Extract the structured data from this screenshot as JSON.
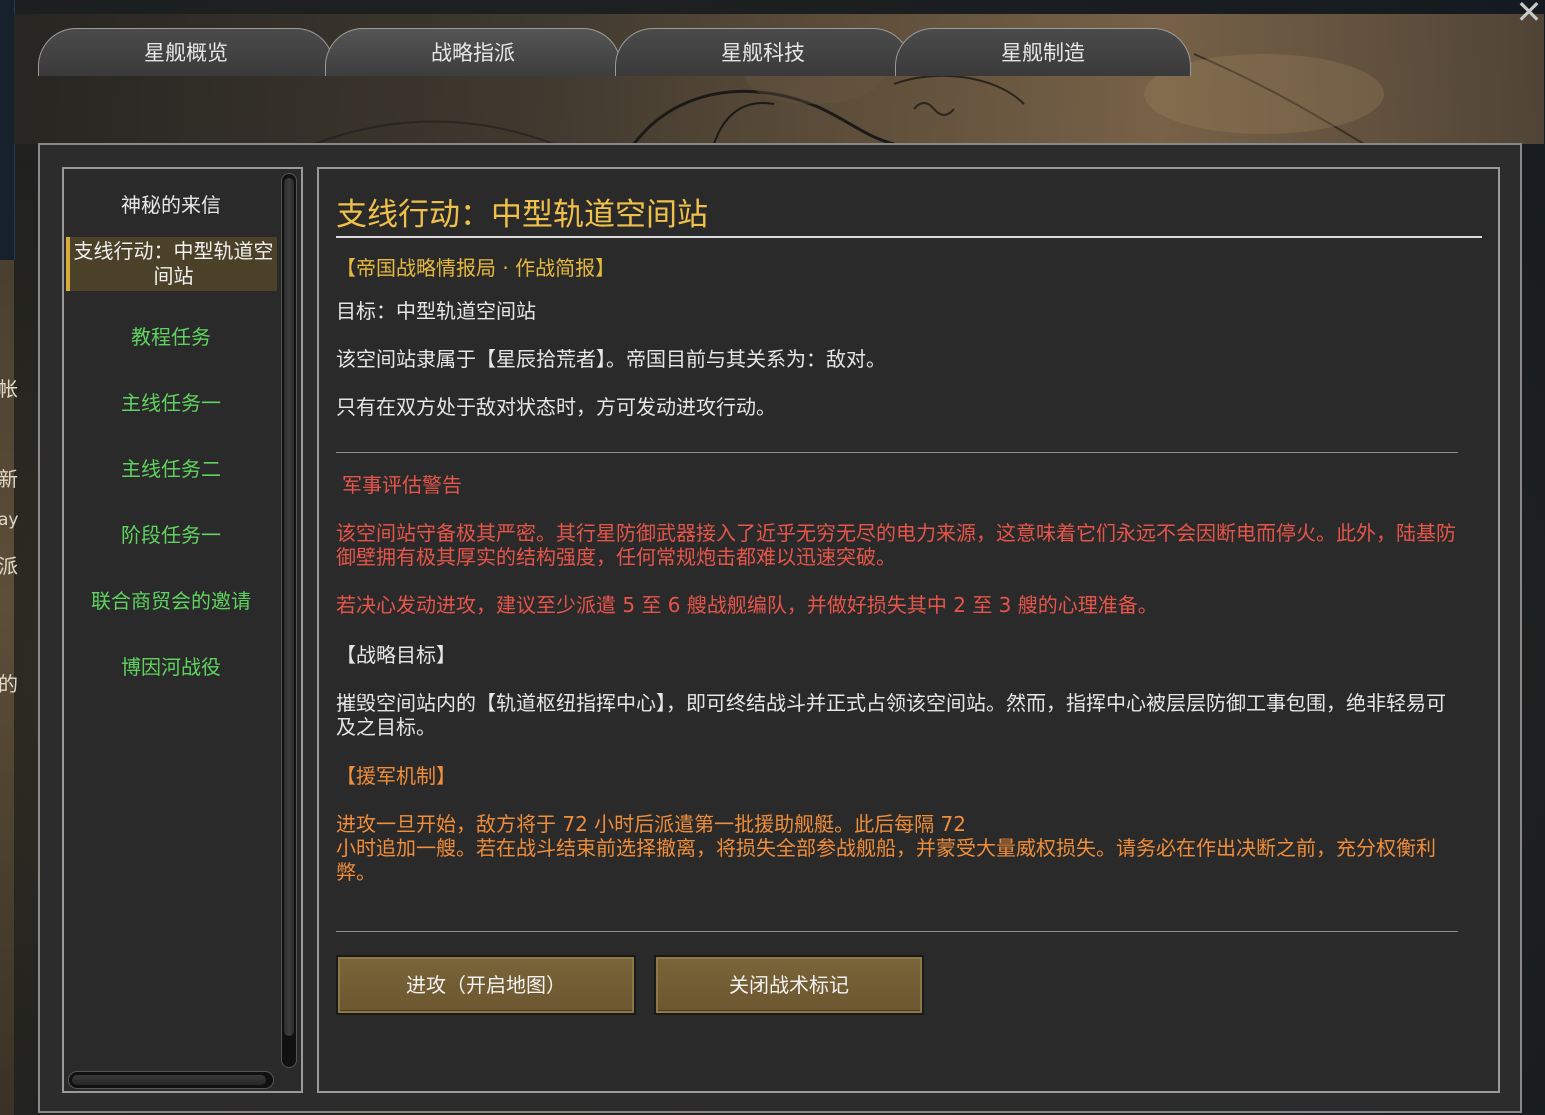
{
  "tabs": [
    {
      "label": "星舰概览"
    },
    {
      "label": "战略指派"
    },
    {
      "label": "星舰科技"
    },
    {
      "label": "星舰制造"
    }
  ],
  "close_symbol": "✕",
  "background_edge_glyphs": [
    "帐",
    "新",
    "ay",
    "派",
    "的"
  ],
  "missions": [
    {
      "label": "神秘的来信",
      "color": "#e8e8e8"
    },
    {
      "label": "支线行动：中型轨道空间站",
      "color": "#f0f0f0",
      "selected": true
    },
    {
      "label": "教程任务",
      "color": "#5fd35f"
    },
    {
      "label": "主线任务一",
      "color": "#5fd35f"
    },
    {
      "label": "主线任务二",
      "color": "#5fd35f"
    },
    {
      "label": "阶段任务一",
      "color": "#5fd35f"
    },
    {
      "label": "联合商贸会的邀请",
      "color": "#5fd35f"
    },
    {
      "label": "博因河战役",
      "color": "#5fd35f"
    }
  ],
  "content": {
    "title": "支线行动：中型轨道空间站",
    "briefing_header": "【帝国战略情报局 · 作战简报】",
    "target": "目标：中型轨道空间站",
    "affiliation": "该空间站隶属于【星辰拾荒者】。帝国目前与其关系为：敌对。",
    "condition": "只有在双方处于敌对状态时，方可发动进攻行动。",
    "warning_header": "军事评估警告",
    "warning_text": "该空间站守备极其严密。其行星防御武器接入了近乎无穷无尽的电力来源，这意味着它们永远不会因断电而停火。此外，陆基防御壁拥有极其厚实的结构强度，任何常规炮击都难以迅速突破。",
    "recommendation": "若决心发动进攻，建议至少派遣 5 至 6 艘战舰编队，并做好损失其中 2 至 3 艘的心理准备。",
    "objective_header": "【战略目标】",
    "objective_text": "摧毁空间站内的【轨道枢纽指挥中心】，即可终结战斗并正式占领该空间站。然而，指挥中心被层层防御工事包围，绝非轻易可及之目标。",
    "reinforcement_header": "【援军机制】",
    "reinforcement_line1": "进攻一旦开始，敌方将于 72 小时后派遣第一批援助舰艇。此后每隔 72",
    "reinforcement_line2": "小时追加一艘。若在战斗结束前选择撤离，将损失全部参战舰船，并蒙受大量威权损失。请务必在作出决断之前，充分权衡利弊。"
  },
  "buttons": {
    "attack": "进攻（开启地图）",
    "close_notes": "关闭战术标记"
  },
  "colors": {
    "title_gold": "#f0c14a",
    "warning_red": "#e6554a",
    "reinforcement_orange": "#ef8d3a",
    "mission_green": "#5fd35f",
    "button_brown": "#7a6438"
  }
}
